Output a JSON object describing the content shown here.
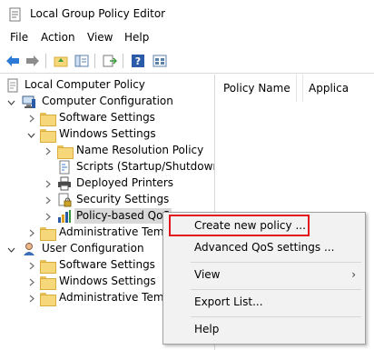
{
  "window": {
    "title": "Local Group Policy Editor"
  },
  "menubar": {
    "items": [
      "File",
      "Action",
      "View",
      "Help"
    ]
  },
  "toolbar": {
    "buttons": [
      "back-icon",
      "forward-icon",
      "up-folder-icon",
      "show-hide-tree-icon",
      "export-list-icon",
      "help-icon",
      "properties-icon"
    ]
  },
  "tree": {
    "root": "Local Computer Policy",
    "computer_config": "Computer Configuration",
    "software_settings": "Software Settings",
    "windows_settings": "Windows Settings",
    "name_resolution_policy": "Name Resolution Policy",
    "scripts": "Scripts (Startup/Shutdown)",
    "deployed_printers": "Deployed Printers",
    "security_settings": "Security Settings",
    "policy_qos": "Policy-based QoS",
    "admin_templates": "Administrative Templ",
    "user_config": "User Configuration",
    "user_software_settings": "Software Settings",
    "user_windows_settings": "Windows Settings",
    "user_admin_templates": "Administrative Templ"
  },
  "right_pane": {
    "columns": [
      "Policy Name",
      "Applica"
    ]
  },
  "context_menu": {
    "create_new_policy": "Create new policy ...",
    "advanced_qos": "Advanced QoS settings ...",
    "view": "View",
    "export_list": "Export List...",
    "help": "Help"
  },
  "colors": {
    "highlight_border": "#e3161b",
    "menu_bg": "#f2f2f2"
  }
}
